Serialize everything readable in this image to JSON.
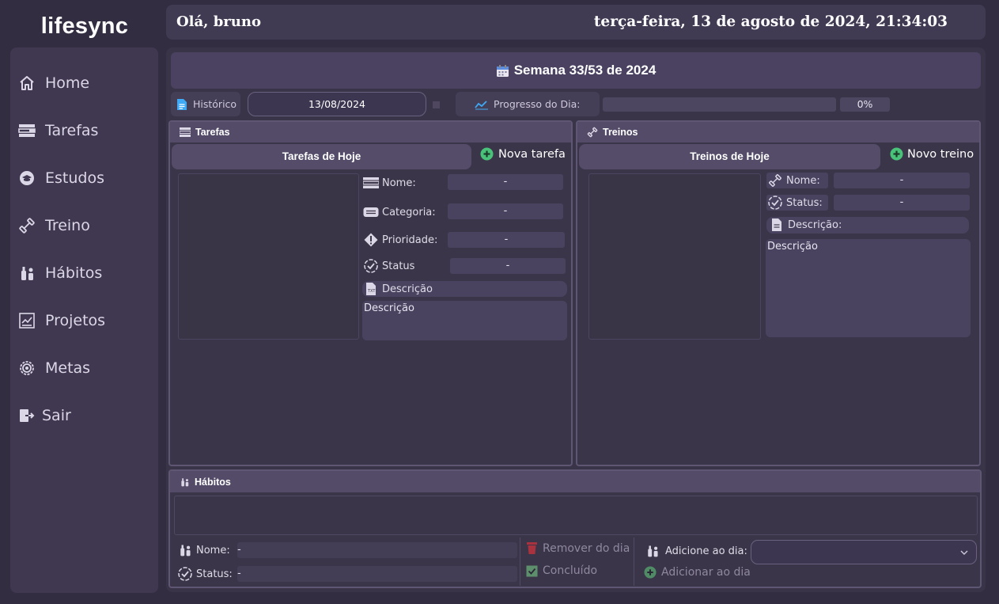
{
  "app": {
    "logo": "lifesync"
  },
  "header": {
    "greeting": "Olá, bruno",
    "datetime": "terça-feira, 13 de agosto de 2024, 21:34:03"
  },
  "sidebar": {
    "items": [
      {
        "label": "Home",
        "icon": "home-icon"
      },
      {
        "label": "Tarefas",
        "icon": "tasks-icon"
      },
      {
        "label": "Estudos",
        "icon": "graduation-cap-icon"
      },
      {
        "label": "Treino",
        "icon": "dumbbell-icon"
      },
      {
        "label": "Hábitos",
        "icon": "habits-icon"
      },
      {
        "label": "Projetos",
        "icon": "chart-icon"
      },
      {
        "label": "Metas",
        "icon": "target-icon"
      },
      {
        "label": "Sair",
        "icon": "logout-icon"
      }
    ]
  },
  "week": {
    "title": "Semana 33/53 de 2024"
  },
  "toolbar": {
    "history_label": "Histórico",
    "date_value": "13/08/2024",
    "progress_label": "Progresso do Dia:",
    "progress_value": 0,
    "progress_text": "0%"
  },
  "tasks": {
    "panel_title": "Tarefas",
    "today_button": "Tarefas de Hoje",
    "new_button": "Nova tarefa",
    "fields": [
      {
        "label": "Nome:",
        "value": "-",
        "icon": "list-icon"
      },
      {
        "label": "Categoria:",
        "value": "-",
        "icon": "category-icon"
      },
      {
        "label": "Prioridade:",
        "value": "-",
        "icon": "priority-icon"
      },
      {
        "label": "Status",
        "value": "-",
        "icon": "status-icon"
      }
    ],
    "description_label": "Descrição",
    "description_text": "Descrição"
  },
  "workouts": {
    "panel_title": "Treinos",
    "today_button": "Treinos de Hoje",
    "new_button": "Novo treino",
    "fields": [
      {
        "label": "Nome:",
        "value": "-",
        "icon": "dumbbell-icon"
      },
      {
        "label": "Status:",
        "value": "-",
        "icon": "status-icon"
      }
    ],
    "description_label": "Descrição:",
    "description_text": "Descrição"
  },
  "habits": {
    "panel_title": "Hábitos",
    "name_label": "Nome:",
    "name_value": "-",
    "status_label": "Status:",
    "status_value": "-",
    "remove_label": "Remover do dia",
    "done_label": "Concluído",
    "add_day_label": "Adicione ao dia:",
    "add_button": "Adicionar ao dia"
  },
  "colors": {
    "accent_green": "#6fd1a4",
    "add_green": "#49c27a",
    "delete_red": "#a9323f"
  }
}
